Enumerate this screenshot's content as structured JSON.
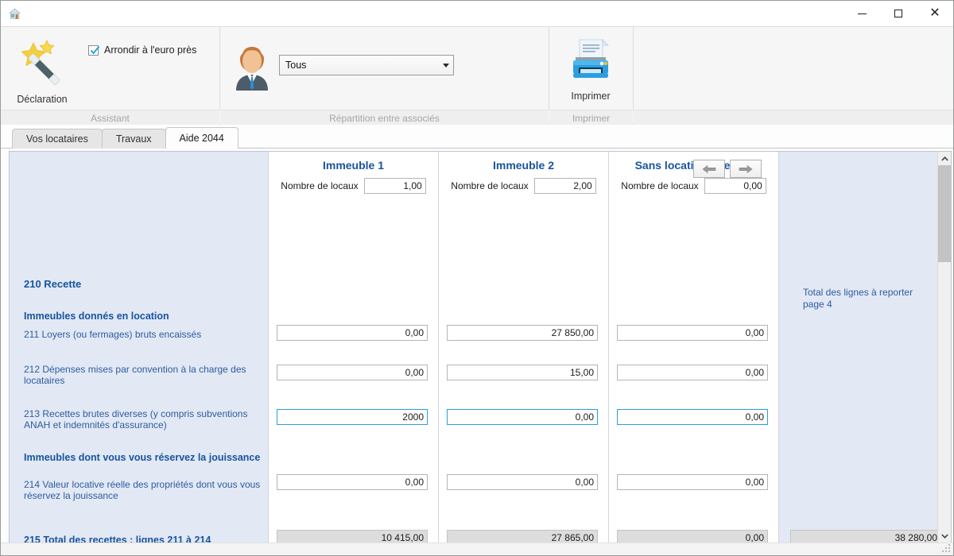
{
  "window": {
    "app_icon": "house-icon",
    "minimize_label": "—",
    "maximize_label": "□",
    "close_label": "✕"
  },
  "ribbon": {
    "groups": [
      {
        "title": "Assistant",
        "button_label": "Déclaration",
        "button_icon": "magic-wand-icon",
        "checkbox_label": "Arrondir à l'euro près",
        "checkbox_checked": true
      },
      {
        "title": "Répartition entre associés",
        "icon": "person-icon",
        "combo_value": "Tous",
        "combo_options": [
          "Tous"
        ]
      },
      {
        "title": "Imprimer",
        "button_label": "Imprimer",
        "button_icon": "printer-icon"
      }
    ]
  },
  "tabs": [
    {
      "label": "Vos locataires",
      "active": false
    },
    {
      "label": "Travaux",
      "active": false
    },
    {
      "label": "Aide 2044",
      "active": true
    }
  ],
  "nav": {
    "prev_icon": "arrow-left-icon",
    "prev_label": "←",
    "next_icon": "arrow-right-icon",
    "next_label": "→"
  },
  "form": {
    "columns": [
      {
        "header": "Immeuble 1",
        "locaux_label": "Nombre de locaux",
        "locaux_value": "1,00"
      },
      {
        "header": "Immeuble 2",
        "locaux_label": "Nombre de locaux",
        "locaux_value": "2,00"
      },
      {
        "header": "Sans location affectée",
        "locaux_label": "Nombre de locaux",
        "locaux_value": "0,00"
      }
    ],
    "total_panel": {
      "note": "Total des lignes à reporter page 4",
      "total_value": "38 280,00"
    },
    "rows": [
      {
        "id": "210",
        "label": "210 Recette",
        "style": "heading1",
        "values": []
      },
      {
        "id": "immeubles-location",
        "label": "Immeubles donnés en location",
        "style": "heading2",
        "values": []
      },
      {
        "id": "211",
        "label": "211 Loyers (ou fermages) bruts encaissés",
        "style": "field",
        "values": [
          "0,00",
          "27 850,00",
          "0,00"
        ],
        "focused": false
      },
      {
        "id": "212",
        "label": "212 Dépenses mises par convention à la charge des locataires",
        "style": "field",
        "values": [
          "0,00",
          "15,00",
          "0,00"
        ],
        "focused": false
      },
      {
        "id": "213",
        "label": "213 Recettes brutes diverses (y compris subventions ANAH et indemnités d'assurance)",
        "style": "field",
        "values": [
          "2000",
          "0,00",
          "0,00"
        ],
        "focused": true
      },
      {
        "id": "immeubles-jouissance",
        "label": "Immeubles dont vous vous réservez la jouissance",
        "style": "heading2",
        "values": []
      },
      {
        "id": "214",
        "label": "214 Valeur locative réelle des propriétés dont vous vous réservez la jouissance",
        "style": "field",
        "values": [
          "0,00",
          "0,00",
          "0,00"
        ],
        "focused": false
      },
      {
        "id": "215",
        "label": "215 Total des recettes : lignes 211 à 214",
        "style": "total",
        "values": [
          "10 415,00",
          "27 865,00",
          "0,00"
        ],
        "focused": false
      }
    ]
  },
  "colors": {
    "accent_blue": "#17549e",
    "label_blue": "#2d5d9f",
    "panel_blue": "#e2e8f4",
    "divider_blue": "#1e5f9e",
    "focus_border": "#2a9fd6"
  }
}
